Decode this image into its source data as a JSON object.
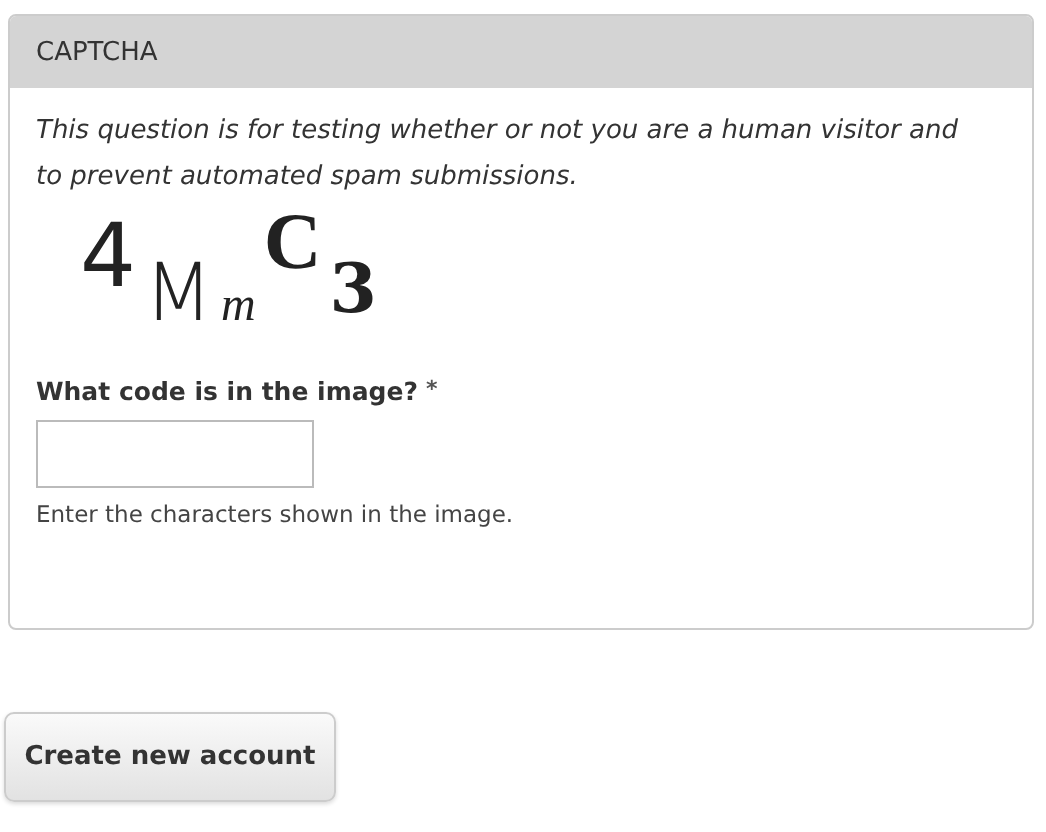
{
  "fieldset": {
    "legend": "CAPTCHA",
    "description": "This question is for testing whether or not you are a human visitor and to prevent automated spam submissions.",
    "captcha_image": {
      "characters": [
        "4",
        "M",
        "m",
        "C",
        "3"
      ]
    },
    "field": {
      "label": "What code is in the image?",
      "required_mark": "*",
      "hint": "Enter the characters shown in the image."
    }
  },
  "buttons": [
    {
      "label": "Create new account"
    }
  ]
}
